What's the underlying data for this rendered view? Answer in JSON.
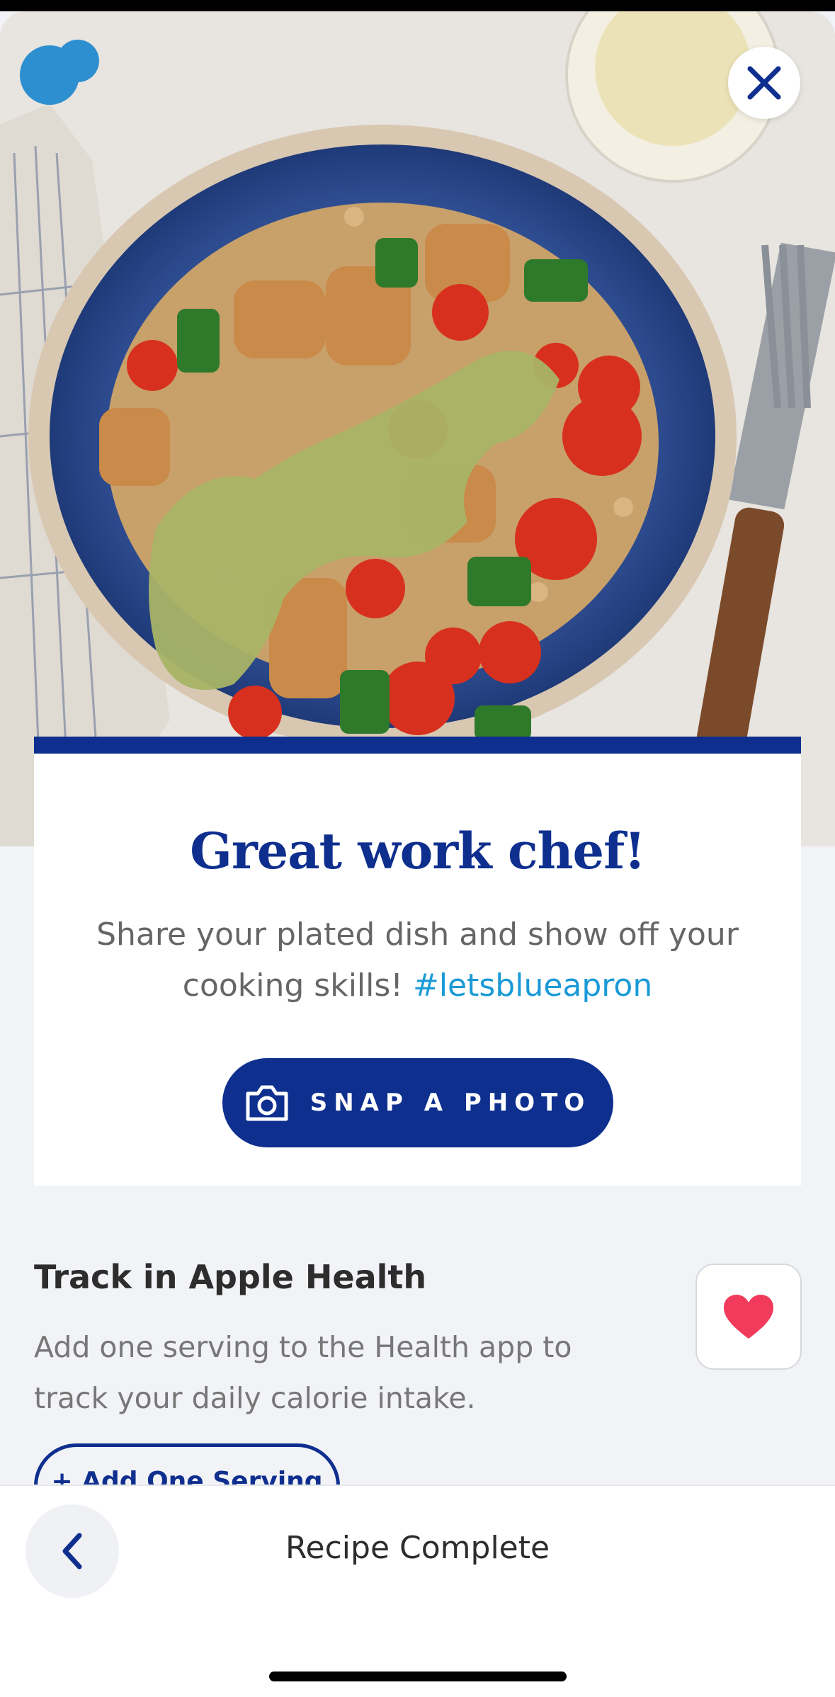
{
  "hero": {
    "close_icon": "close-icon",
    "image": "grain bowl with chicken, tomatoes, peppers and pesto"
  },
  "card": {
    "headline": "Great work chef!",
    "share_text": "Share your plated dish and show off your cooking skills!",
    "hashtag": "#letsblueapron",
    "snap_button_label": "SNAP A PHOTO",
    "snap_icon": "camera-icon"
  },
  "health": {
    "title": "Track in Apple Health",
    "description": "Add one serving to the Health app to track your daily calorie intake.",
    "add_button_label": "+ Add One Serving",
    "badge_icon": "heart-icon"
  },
  "bottom_bar": {
    "title": "Recipe Complete",
    "back_icon": "chevron-left-icon"
  },
  "colors": {
    "brand_blue": "#0f2f8f",
    "hashtag_blue": "#1a9ad6",
    "heart_red": "#f23a5c"
  }
}
